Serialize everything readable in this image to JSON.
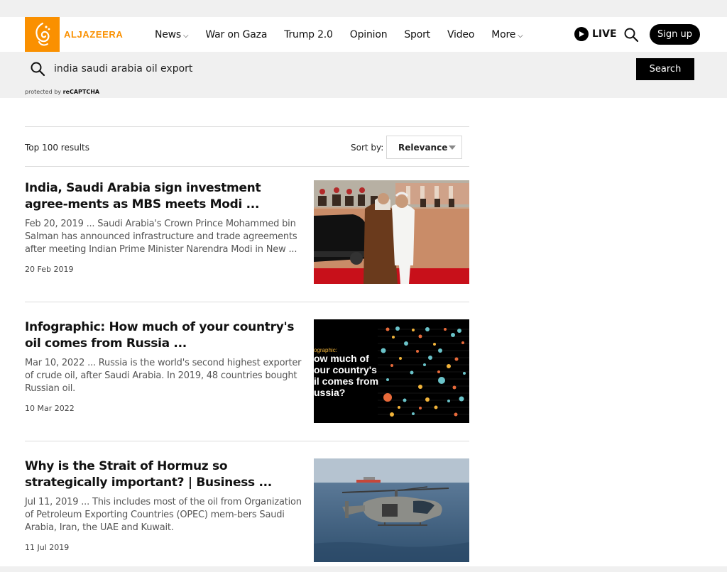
{
  "header": {
    "logo_text": "ALJAZEERA",
    "nav": [
      {
        "label": "News",
        "dropdown": true
      },
      {
        "label": "War on Gaza",
        "dropdown": false
      },
      {
        "label": "Trump 2.0",
        "dropdown": false
      },
      {
        "label": "Opinion",
        "dropdown": false
      },
      {
        "label": "Sport",
        "dropdown": false
      },
      {
        "label": "Video",
        "dropdown": false
      },
      {
        "label": "More",
        "dropdown": true
      }
    ],
    "live_label": "LIVE",
    "signup_label": "Sign up"
  },
  "search": {
    "query": "india saudi arabia oil export",
    "button_label": "Search",
    "recaptcha_prefix": "protected by",
    "recaptcha_brand": "reCAPTCHA"
  },
  "results": {
    "count_label": "Top 100 results",
    "sort_label": "Sort by:",
    "sort_value": "Relevance",
    "items": [
      {
        "title": "India, Saudi Arabia sign investment agree-ments as MBS meets Modi ...",
        "snippet": "Feb 20, 2019 ... Saudi Arabia's Crown Prince Mohammed bin Salman has announced infrastructure and trade agreements after meeting Indian Prime Minister Narendra Modi in New ...",
        "date": "20 Feb 2019"
      },
      {
        "title": "Infographic: How much of your country's oil comes from Russia ...",
        "snippet": "Mar 10, 2022 ... Russia is the world's second highest exporter of crude oil, after Saudi Arabia. In 2019, 48 countries bought Russian oil.",
        "date": "10 Mar 2022",
        "image_text": [
          "ographic:",
          "ow much of",
          "our country's",
          "il comes from",
          "ussia?"
        ]
      },
      {
        "title": "Why is the Strait of Hormuz so strategically important? | Business ...",
        "snippet": "Jul 11, 2019 ... This includes most of the oil from Organization of Petroleum Exporting Countries (OPEC) mem-bers Saudi Arabia, Iran, the UAE and Kuwait.",
        "date": "11 Jul 2019"
      }
    ]
  },
  "colors": {
    "brand": "#fa9000",
    "black": "#000000"
  }
}
